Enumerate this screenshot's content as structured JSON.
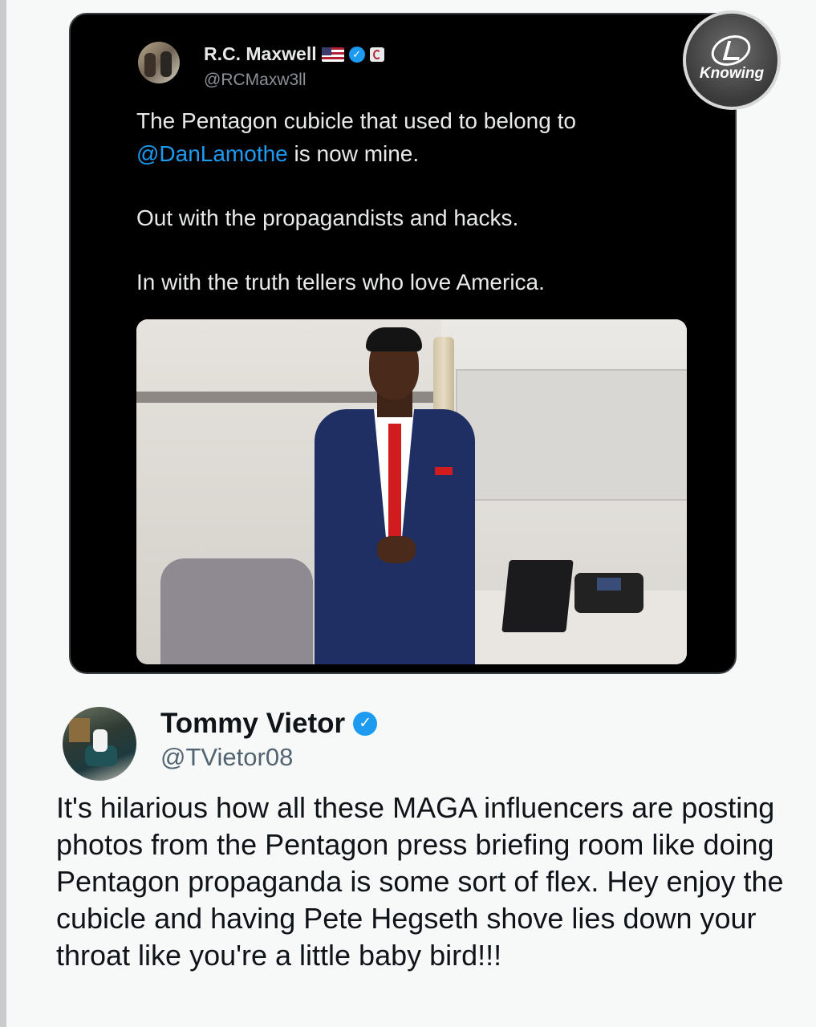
{
  "quoted_tweet": {
    "author_name": "R.C. Maxwell",
    "author_handle": "@RCMaxw3ll",
    "text_line1": "The Pentagon cubicle that used to belong to",
    "mention": "@DanLamothe",
    "text_line1_rest": " is now mine.",
    "text_para2": "Out with the propagandists and hacks.",
    "text_para3": "In with the truth tellers who love America.",
    "icons": [
      "us-flag-icon",
      "verified-icon",
      "affiliate-badge-icon"
    ]
  },
  "watermark": {
    "text": "Knowing"
  },
  "main_tweet": {
    "author_name": "Tommy Vietor",
    "author_handle": "@TVietor08",
    "text": "It's hilarious how all these MAGA influencers are posting photos from the Pentagon press briefing room like doing Pentagon propaganda is some sort of flex. Hey enjoy the cubicle and having Pete Hegseth shove lies down your throat like you're a little baby bird!!!"
  },
  "colors": {
    "link": "#1d9bf0",
    "verified": "#1d9bf0",
    "dark_card_bg": "#000000"
  }
}
